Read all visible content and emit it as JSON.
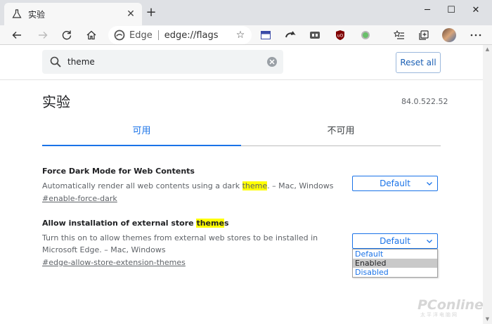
{
  "browser": {
    "tab_title": "实验",
    "tab_icon": "flask-icon",
    "omnibox_brand": "Edge",
    "url": "edge://flags",
    "window_controls": [
      "─",
      "☐",
      "✕"
    ]
  },
  "search": {
    "value": "theme",
    "reset_label": "Reset all"
  },
  "page": {
    "title": "实验",
    "version": "84.0.522.52",
    "tab_available": "可用",
    "tab_unavailable": "不可用"
  },
  "flags": [
    {
      "title_before": "Force Dark Mode for Web Contents",
      "title_mark": "",
      "title_after": "",
      "desc_before": "Automatically render all web contents using a dark ",
      "desc_mark": "theme",
      "desc_after": ". – Mac, Windows",
      "link": "#enable-force-dark",
      "select_value": "Default"
    },
    {
      "title_before": "Allow installation of external store ",
      "title_mark": "theme",
      "title_after": "s",
      "desc_before": "Turn this on to allow themes from external web stores to be installed in Microsoft Edge. – Mac, Windows",
      "desc_mark": "",
      "desc_after": "",
      "link": "#edge-allow-store-extension-themes",
      "select_value": "Default"
    }
  ],
  "dropdown_options": [
    "Default",
    "Enabled",
    "Disabled"
  ],
  "dropdown_selected": "Enabled",
  "watermark": {
    "main": "PConline",
    "sub": "太平洋电脑网"
  },
  "colors": {
    "accent": "#1a73e8",
    "highlight": "#ffff00",
    "tabstrip": "#dfe1e5",
    "toolbar": "#f7f7f7"
  }
}
